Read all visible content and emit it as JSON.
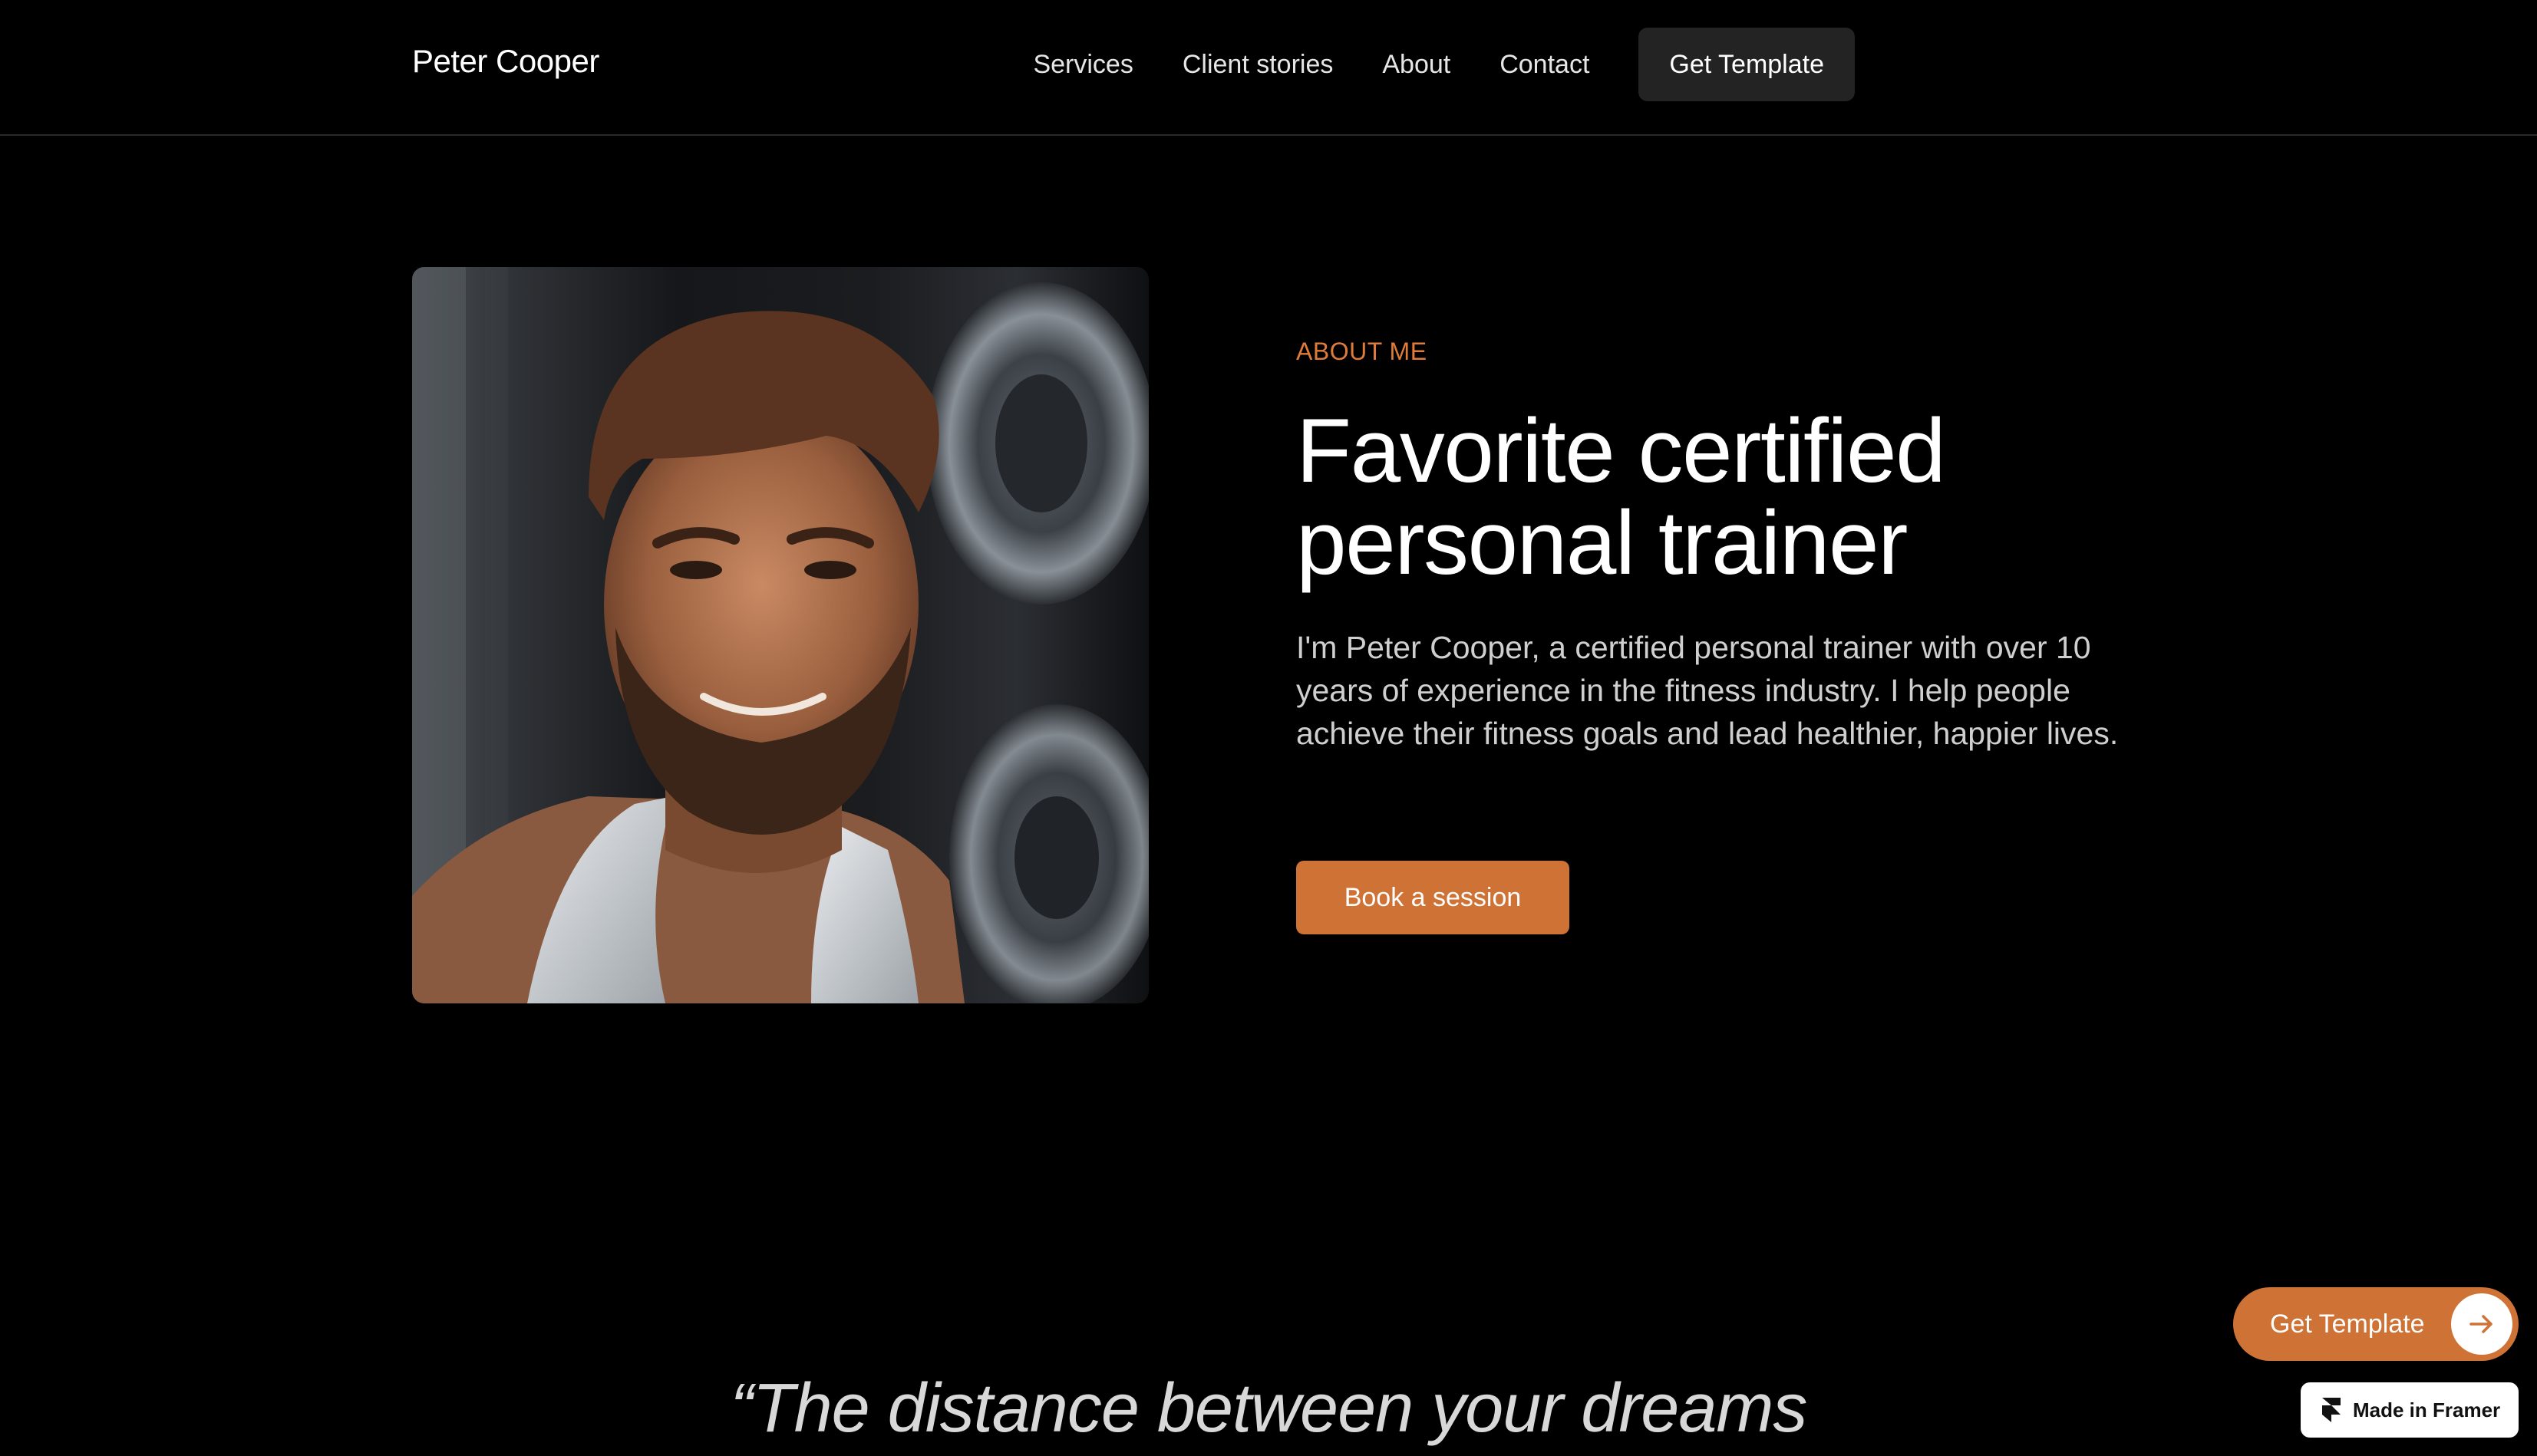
{
  "nav": {
    "brand": "Peter Cooper",
    "links": [
      "Services",
      "Client stories",
      "About",
      "Contact"
    ],
    "cta": "Get Template"
  },
  "hero": {
    "portrait_icon": "trainer-portrait",
    "eyebrow": "ABOUT ME",
    "headline_line1": "Favorite certified",
    "headline_line2": "personal trainer",
    "lead": "I'm Peter Cooper, a certified personal trainer with over 10 years of experience in the fitness industry. I help people achieve their fitness goals and lead healthier, happier lives.",
    "button": "Book a session"
  },
  "quote": {
    "text": "“The distance between your dreams"
  },
  "floating": {
    "cta_label": "Get Template",
    "cta_icon": "arrow-right-icon",
    "badge_label": "Made in Framer",
    "badge_icon": "framer-logo-icon"
  },
  "colors": {
    "background": "#000000",
    "accent": "#cf7236",
    "eyebrow": "#e07b39",
    "nav_button": "#232323",
    "body_text": "#cfcfcf"
  }
}
